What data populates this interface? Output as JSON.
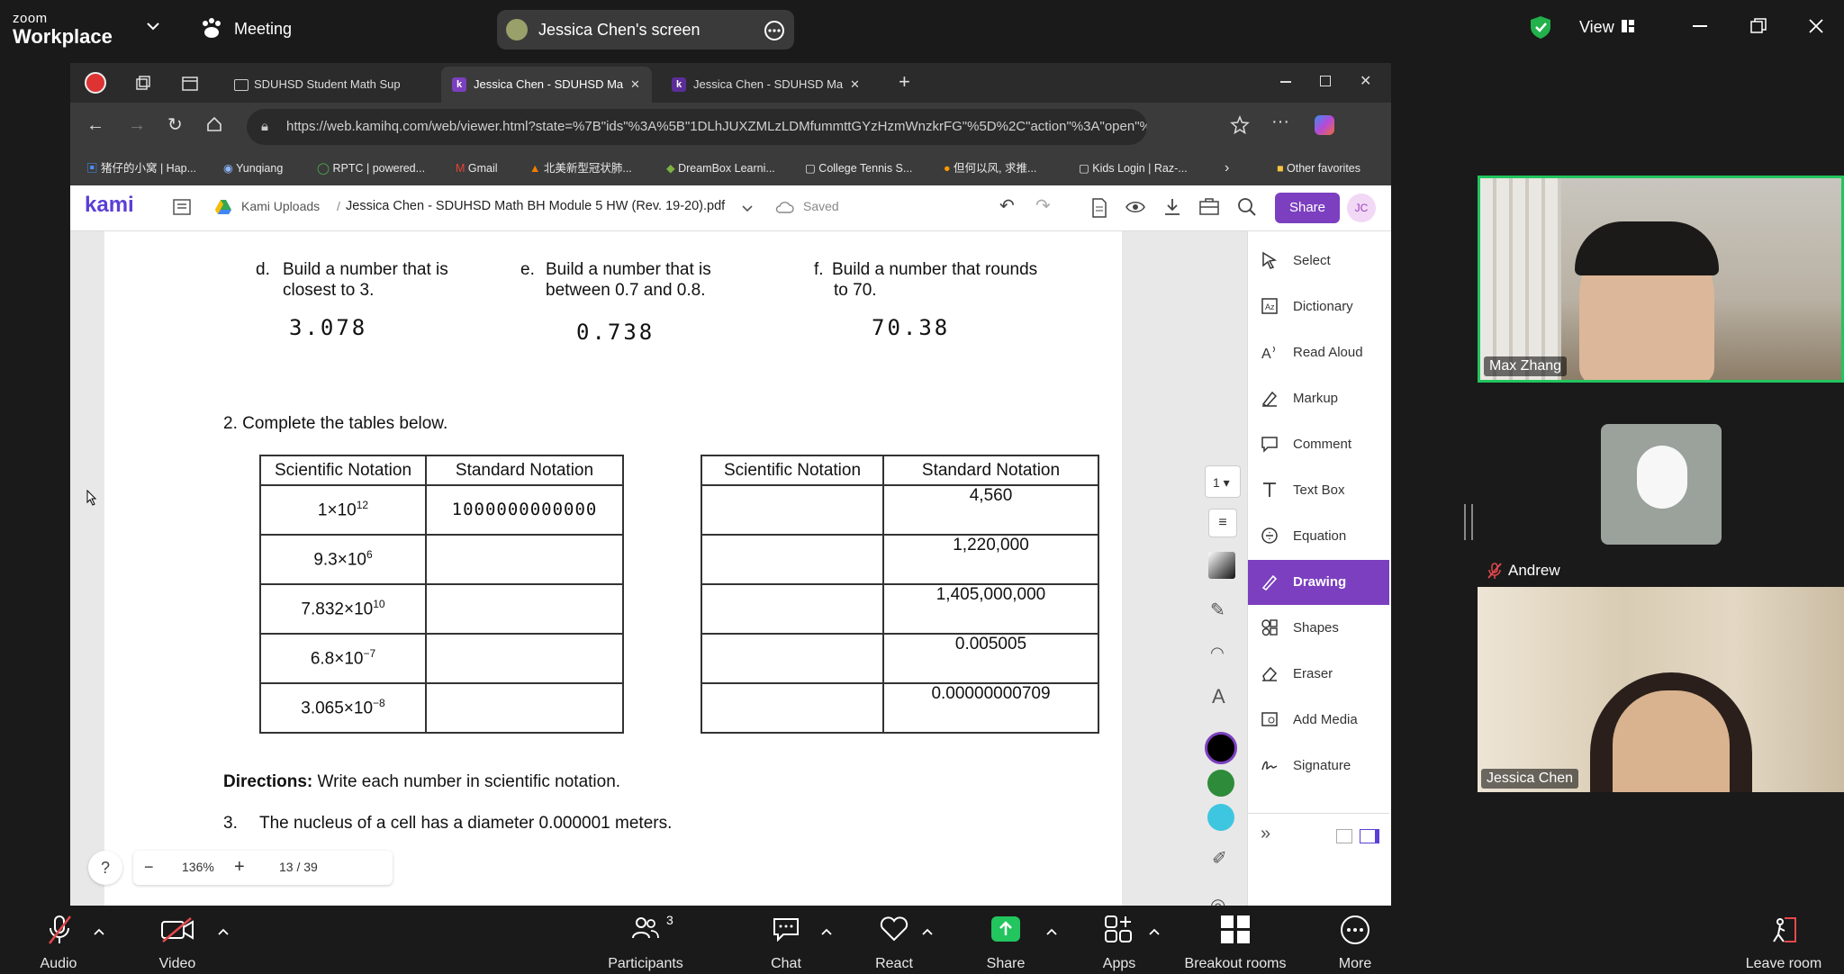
{
  "zoom": {
    "logo_top": "zoom",
    "logo_bottom": "Workplace",
    "meeting_label": "Meeting",
    "screen_share_label": "Jessica Chen's screen",
    "view_label": "View"
  },
  "browser": {
    "tabs": [
      {
        "label": "SDUHSD Student Math Sup"
      },
      {
        "label": "Jessica Chen - SDUHSD Ma"
      },
      {
        "label": "Jessica Chen - SDUHSD Ma"
      }
    ],
    "url": "https://web.kamihq.com/web/viewer.html?state=%7B\"ids\"%3A%5B\"1DLhJUXZMLzLDMfummttGYzHzmWnzkrFG\"%5D%2C\"action\"%3A\"open\"%2C\"u...",
    "bookmarks": [
      "猪仔的小窝 | Hap...",
      "Yunqiang",
      "RPTC | powered...",
      "Gmail",
      "北美新型冠状肺...",
      "DreamBox Learni...",
      "College Tennis S...",
      "但何以风, 求推...",
      "Kids Login | Raz-..."
    ],
    "other_favorites": "Other favorites"
  },
  "kami": {
    "logo": "kami",
    "breadcrumb_root": "Kami Uploads",
    "separator": "/",
    "file_name": "Jessica Chen - SDUHSD Math BH Module 5 HW (Rev. 19-20).pdf",
    "saved_label": "Saved",
    "share_label": "Share",
    "avatar_initials": "JC",
    "page_select": "1",
    "tools": [
      "Select",
      "Dictionary",
      "Read Aloud",
      "Markup",
      "Comment",
      "Text Box",
      "Equation",
      "Drawing",
      "Shapes",
      "Eraser",
      "Add Media",
      "Signature"
    ],
    "active_tool": "Drawing",
    "zoom_level": "136%",
    "page_indicator": "13 / 39",
    "colors": {
      "accent": "#7b3fbf",
      "black": "#000000",
      "green": "#2e8b3a",
      "cyan": "#3ec6e0"
    }
  },
  "document": {
    "q_d_letter": "d.",
    "q_d_line1": "Build a number that is",
    "q_d_line2": "closest to 3.",
    "q_d_answer": "3.078",
    "q_e_letter": "e.",
    "q_e_line1": "Build a number that is",
    "q_e_line2": "between 0.7 and 0.8.",
    "q_e_answer": "0.738",
    "q_f_letter": "f.",
    "q_f_line1": "Build a number that rounds",
    "q_f_line2": "to 70.",
    "q_f_answer": "70.38",
    "section2": "2.  Complete the tables below.",
    "table_left": {
      "headers": [
        "Scientific Notation",
        "Standard Notation"
      ],
      "rows": [
        {
          "coef": "1×10",
          "exp": "12",
          "standard": "1000000000000"
        },
        {
          "coef": "9.3×10",
          "exp": "6",
          "standard": ""
        },
        {
          "coef": "7.832×10",
          "exp": "10",
          "standard": ""
        },
        {
          "coef": "6.8×10",
          "exp": "−7",
          "standard": ""
        },
        {
          "coef": "3.065×10",
          "exp": "−8",
          "standard": ""
        }
      ]
    },
    "table_right": {
      "headers": [
        "Scientific Notation",
        "Standard Notation"
      ],
      "rows": [
        {
          "scientific": "",
          "standard": "4,560"
        },
        {
          "scientific": "",
          "standard": "1,220,000"
        },
        {
          "scientific": "",
          "standard": "1,405,000,000"
        },
        {
          "scientific": "",
          "standard": "0.005005"
        },
        {
          "scientific": "",
          "standard": "0.00000000709"
        }
      ]
    },
    "directions_bold": "Directions:",
    "directions_text": "Write each number in scientific notation.",
    "q3_number": "3.",
    "q3_text": "The nucleus of a cell has a diameter 0.000001 meters."
  },
  "participants": [
    {
      "name": "Max Zhang"
    },
    {
      "name": "Andrew"
    },
    {
      "name": "Jessica Chen"
    }
  ],
  "bottom_bar": {
    "audio": "Audio",
    "video": "Video",
    "participants": "Participants",
    "participants_count": "3",
    "chat": "Chat",
    "react": "React",
    "share": "Share",
    "apps": "Apps",
    "breakout": "Breakout rooms",
    "more": "More",
    "leave": "Leave room"
  }
}
